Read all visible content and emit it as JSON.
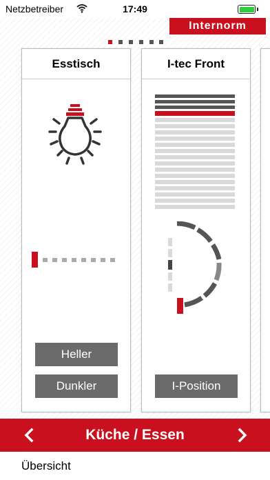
{
  "status_bar": {
    "carrier": "Netzbetreiber",
    "time": "17:49",
    "battery_level": 1.0
  },
  "brand": {
    "logo_text": "Internorm",
    "color": "#c8101e"
  },
  "pager": {
    "page_count": 6,
    "active_index": 0
  },
  "cards": [
    {
      "title": "Esstisch",
      "icon": "light-bulb-icon",
      "dimmer_level": 0,
      "buttons": {
        "brighter": "Heller",
        "darker": "Dunkler"
      }
    },
    {
      "title": "I-tec Front",
      "icon": "blind-icon",
      "slat_angle_level": 0,
      "buttons": {
        "position": "I-Position"
      }
    }
  ],
  "room_nav": {
    "title": "Küche / Essen",
    "prev_icon": "chevron-left-icon",
    "next_icon": "chevron-right-icon"
  },
  "overview": {
    "label": "Übersicht"
  },
  "colors": {
    "accent": "#c8101e",
    "button_gray": "#6b6b6b",
    "dark_gray": "#555555",
    "light_gray": "#d9d9d9"
  }
}
